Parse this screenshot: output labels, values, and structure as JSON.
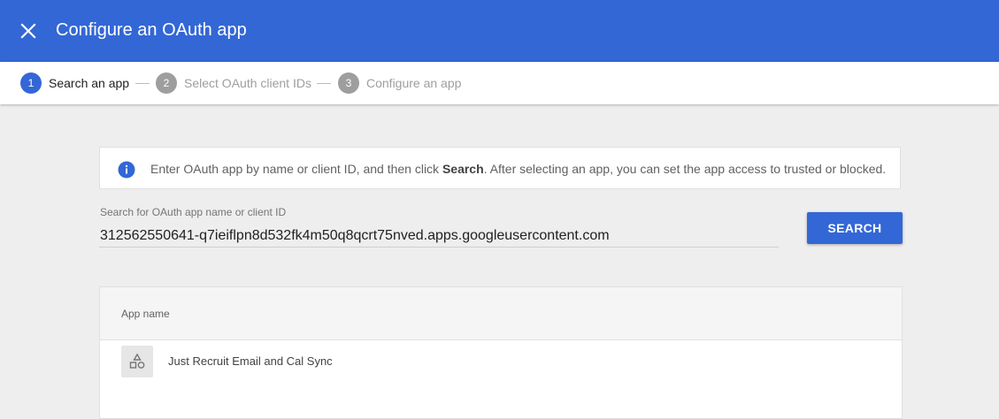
{
  "header": {
    "title": "Configure an OAuth app",
    "close_icon": "close-icon",
    "color": "#3367d6"
  },
  "stepper": {
    "steps": [
      {
        "number": "1",
        "label": "Search an app",
        "active": true
      },
      {
        "number": "2",
        "label": "Select OAuth client IDs",
        "active": false
      },
      {
        "number": "3",
        "label": "Configure an app",
        "active": false
      }
    ]
  },
  "info": {
    "icon": "info-icon",
    "text_before": "Enter OAuth app by name or client ID, and then click ",
    "text_bold": "Search",
    "text_after": ". After selecting an app, you can set the app access to trusted or blocked."
  },
  "search": {
    "label": "Search for OAuth app name or client ID",
    "value": "312562550641-q7ieiflpn8d532fk4m50q8qcrt75nved.apps.googleusercontent.com",
    "button_label": "SEARCH"
  },
  "table": {
    "columns": [
      "App name"
    ],
    "rows": [
      {
        "icon": "app-shapes-icon",
        "name": "Just Recruit Email and Cal Sync"
      }
    ]
  }
}
